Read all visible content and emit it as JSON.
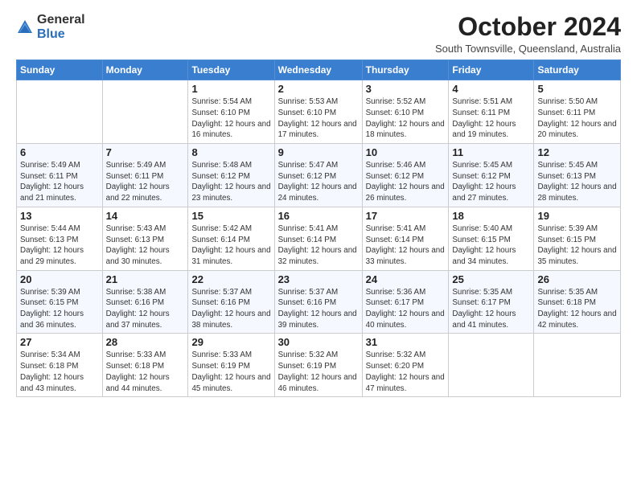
{
  "logo": {
    "general": "General",
    "blue": "Blue"
  },
  "title": "October 2024",
  "subtitle": "South Townsville, Queensland, Australia",
  "days_of_week": [
    "Sunday",
    "Monday",
    "Tuesday",
    "Wednesday",
    "Thursday",
    "Friday",
    "Saturday"
  ],
  "weeks": [
    [
      {
        "day": "",
        "info": ""
      },
      {
        "day": "",
        "info": ""
      },
      {
        "day": "1",
        "sunrise": "5:54 AM",
        "sunset": "6:10 PM",
        "daylight": "12 hours and 16 minutes."
      },
      {
        "day": "2",
        "sunrise": "5:53 AM",
        "sunset": "6:10 PM",
        "daylight": "12 hours and 17 minutes."
      },
      {
        "day": "3",
        "sunrise": "5:52 AM",
        "sunset": "6:10 PM",
        "daylight": "12 hours and 18 minutes."
      },
      {
        "day": "4",
        "sunrise": "5:51 AM",
        "sunset": "6:11 PM",
        "daylight": "12 hours and 19 minutes."
      },
      {
        "day": "5",
        "sunrise": "5:50 AM",
        "sunset": "6:11 PM",
        "daylight": "12 hours and 20 minutes."
      }
    ],
    [
      {
        "day": "6",
        "sunrise": "5:49 AM",
        "sunset": "6:11 PM",
        "daylight": "12 hours and 21 minutes."
      },
      {
        "day": "7",
        "sunrise": "5:49 AM",
        "sunset": "6:11 PM",
        "daylight": "12 hours and 22 minutes."
      },
      {
        "day": "8",
        "sunrise": "5:48 AM",
        "sunset": "6:12 PM",
        "daylight": "12 hours and 23 minutes."
      },
      {
        "day": "9",
        "sunrise": "5:47 AM",
        "sunset": "6:12 PM",
        "daylight": "12 hours and 24 minutes."
      },
      {
        "day": "10",
        "sunrise": "5:46 AM",
        "sunset": "6:12 PM",
        "daylight": "12 hours and 26 minutes."
      },
      {
        "day": "11",
        "sunrise": "5:45 AM",
        "sunset": "6:12 PM",
        "daylight": "12 hours and 27 minutes."
      },
      {
        "day": "12",
        "sunrise": "5:45 AM",
        "sunset": "6:13 PM",
        "daylight": "12 hours and 28 minutes."
      }
    ],
    [
      {
        "day": "13",
        "sunrise": "5:44 AM",
        "sunset": "6:13 PM",
        "daylight": "12 hours and 29 minutes."
      },
      {
        "day": "14",
        "sunrise": "5:43 AM",
        "sunset": "6:13 PM",
        "daylight": "12 hours and 30 minutes."
      },
      {
        "day": "15",
        "sunrise": "5:42 AM",
        "sunset": "6:14 PM",
        "daylight": "12 hours and 31 minutes."
      },
      {
        "day": "16",
        "sunrise": "5:41 AM",
        "sunset": "6:14 PM",
        "daylight": "12 hours and 32 minutes."
      },
      {
        "day": "17",
        "sunrise": "5:41 AM",
        "sunset": "6:14 PM",
        "daylight": "12 hours and 33 minutes."
      },
      {
        "day": "18",
        "sunrise": "5:40 AM",
        "sunset": "6:15 PM",
        "daylight": "12 hours and 34 minutes."
      },
      {
        "day": "19",
        "sunrise": "5:39 AM",
        "sunset": "6:15 PM",
        "daylight": "12 hours and 35 minutes."
      }
    ],
    [
      {
        "day": "20",
        "sunrise": "5:39 AM",
        "sunset": "6:15 PM",
        "daylight": "12 hours and 36 minutes."
      },
      {
        "day": "21",
        "sunrise": "5:38 AM",
        "sunset": "6:16 PM",
        "daylight": "12 hours and 37 minutes."
      },
      {
        "day": "22",
        "sunrise": "5:37 AM",
        "sunset": "6:16 PM",
        "daylight": "12 hours and 38 minutes."
      },
      {
        "day": "23",
        "sunrise": "5:37 AM",
        "sunset": "6:16 PM",
        "daylight": "12 hours and 39 minutes."
      },
      {
        "day": "24",
        "sunrise": "5:36 AM",
        "sunset": "6:17 PM",
        "daylight": "12 hours and 40 minutes."
      },
      {
        "day": "25",
        "sunrise": "5:35 AM",
        "sunset": "6:17 PM",
        "daylight": "12 hours and 41 minutes."
      },
      {
        "day": "26",
        "sunrise": "5:35 AM",
        "sunset": "6:18 PM",
        "daylight": "12 hours and 42 minutes."
      }
    ],
    [
      {
        "day": "27",
        "sunrise": "5:34 AM",
        "sunset": "6:18 PM",
        "daylight": "12 hours and 43 minutes."
      },
      {
        "day": "28",
        "sunrise": "5:33 AM",
        "sunset": "6:18 PM",
        "daylight": "12 hours and 44 minutes."
      },
      {
        "day": "29",
        "sunrise": "5:33 AM",
        "sunset": "6:19 PM",
        "daylight": "12 hours and 45 minutes."
      },
      {
        "day": "30",
        "sunrise": "5:32 AM",
        "sunset": "6:19 PM",
        "daylight": "12 hours and 46 minutes."
      },
      {
        "day": "31",
        "sunrise": "5:32 AM",
        "sunset": "6:20 PM",
        "daylight": "12 hours and 47 minutes."
      },
      {
        "day": "",
        "info": ""
      },
      {
        "day": "",
        "info": ""
      }
    ]
  ]
}
